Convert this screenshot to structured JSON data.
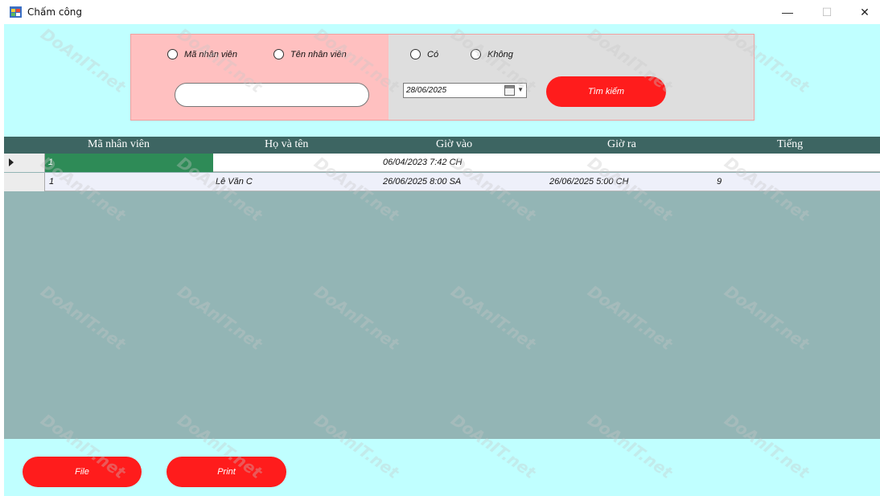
{
  "window": {
    "title": "Chấm công",
    "minimize": "—",
    "maximize": "☐",
    "close": "✕"
  },
  "search": {
    "radio_employee_id": "Mã nhân viên",
    "radio_employee_name": "Tên nhân viên",
    "radio_yes": "Có",
    "radio_no": "Không",
    "keyword_value": "",
    "date_value": "28/06/2025",
    "search_button": "Tìm kiếm"
  },
  "grid": {
    "columns": [
      "Mã nhân viên",
      "Họ và tên",
      "Giờ vào",
      "Giờ ra",
      "Tiếng"
    ],
    "rows": [
      {
        "id": "1",
        "name": "",
        "time_in": "06/04/2023 7:42 CH",
        "time_out": "",
        "hours": ""
      },
      {
        "id": "1",
        "name": "Lê Văn C",
        "time_in": "26/06/2025 8:00 SA",
        "time_out": "26/06/2025 5:00 CH",
        "hours": "9"
      }
    ]
  },
  "footer": {
    "file_button": "File",
    "print_button": "Print"
  },
  "watermark": "DoAnIT.net",
  "colors": {
    "client_bg": "#c0ffff",
    "panel_left": "#ffc0c0",
    "panel_right": "#dedede",
    "button_red": "#ff1c1c",
    "grid_header": "#3d6562",
    "grid_bg": "#93b5b5",
    "selected_cell": "#2e8b57"
  }
}
